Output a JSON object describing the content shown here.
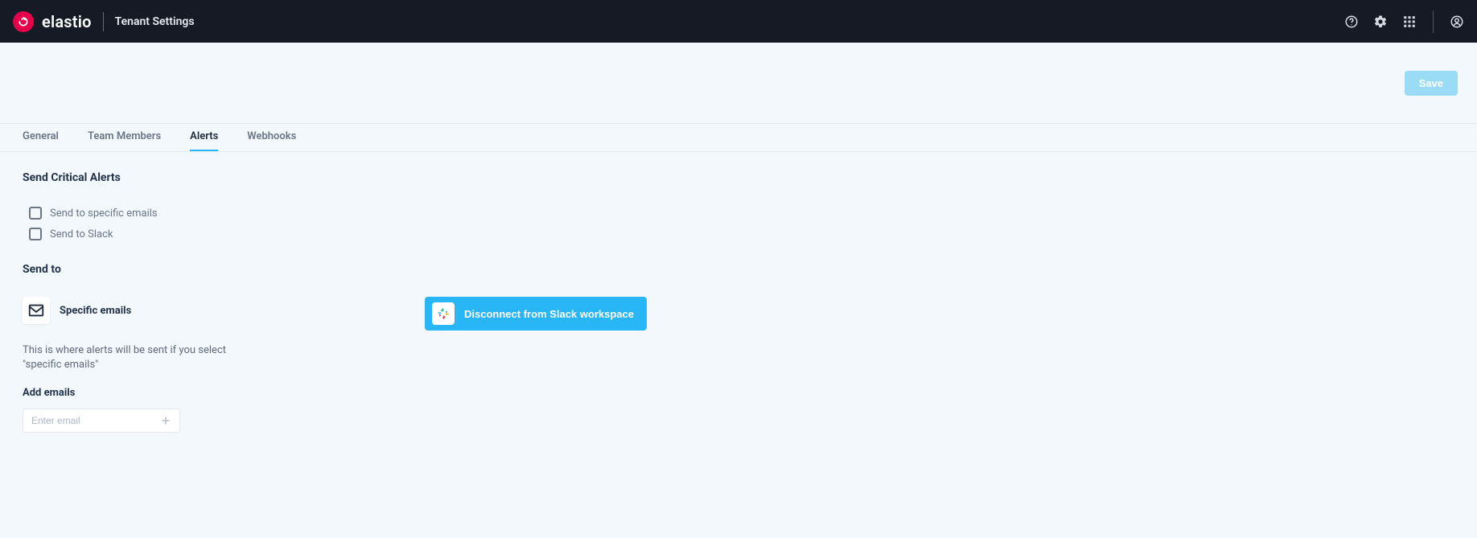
{
  "header": {
    "brand": "elastio",
    "page_title": "Tenant Settings"
  },
  "toolbar": {
    "save_label": "Save"
  },
  "tabs": [
    {
      "label": "General",
      "active": false
    },
    {
      "label": "Team Members",
      "active": false
    },
    {
      "label": "Alerts",
      "active": true
    },
    {
      "label": "Webhooks",
      "active": false
    }
  ],
  "alerts": {
    "section_title": "Send Critical Alerts",
    "checkboxes": {
      "emails_label": "Send to specific emails",
      "slack_label": "Send to Slack"
    },
    "send_to_title": "Send to",
    "specific_emails": {
      "label": "Specific emails",
      "description": "This is where alerts will be sent if you select \"specific emails\"",
      "add_title": "Add emails",
      "input_placeholder": "Enter email"
    },
    "slack": {
      "button_label": "Disconnect from Slack workspace"
    }
  }
}
